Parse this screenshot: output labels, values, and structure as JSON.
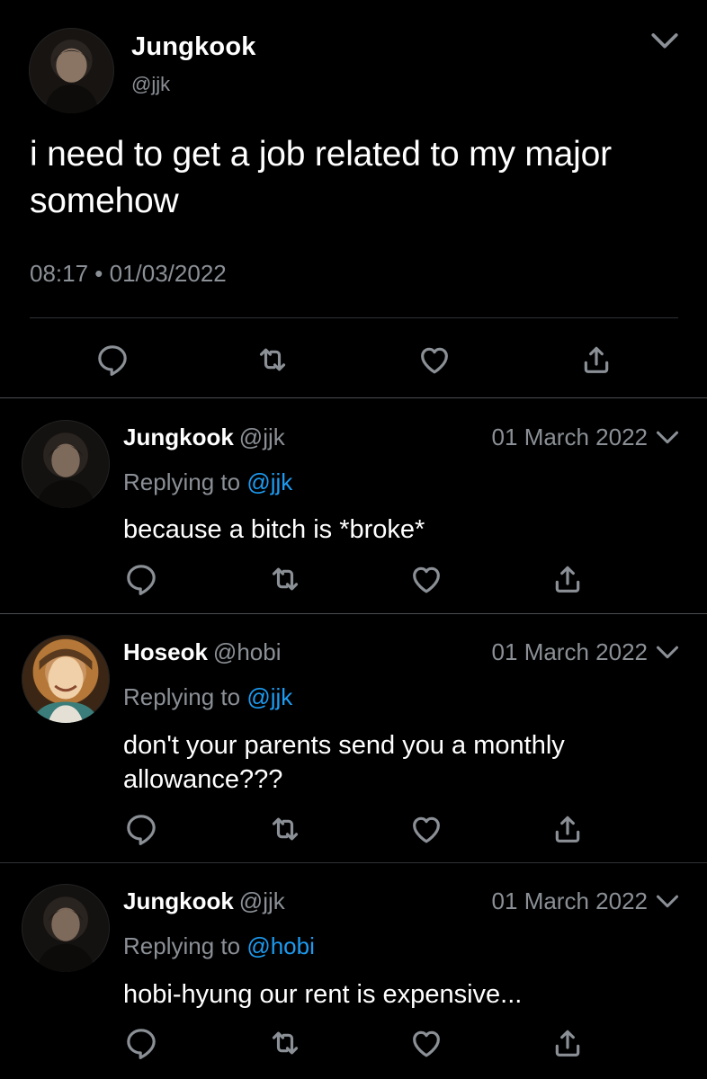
{
  "main_tweet": {
    "author_name": "Jungkook",
    "handle": "@jjk",
    "text": "i need to get a job related to my major somehow",
    "timestamp": "08:17 • 01/03/2022",
    "avatar_icon": "avatar-photo",
    "menu_icon": "chevron-down-icon"
  },
  "replies": [
    {
      "author_name": "Jungkook",
      "handle": "@jjk",
      "date": "01 March 2022",
      "replying_prefix": "Replying to ",
      "replying_to": "@jjk",
      "text": "because a bitch is *broke*"
    },
    {
      "author_name": "Hoseok",
      "handle": "@hobi",
      "date": "01 March 2022",
      "replying_prefix": "Replying to ",
      "replying_to": "@jjk",
      "text": "don't your parents send you a monthly allowance???"
    },
    {
      "author_name": "Jungkook",
      "handle": "@jjk",
      "date": "01 March 2022",
      "replying_prefix": "Replying to ",
      "replying_to": "@hobi",
      "text": "hobi-hyung our rent is expensive..."
    }
  ],
  "actions": [
    "reply-icon",
    "retweet-icon",
    "like-icon",
    "share-icon"
  ],
  "colors": {
    "background": "#000000",
    "text": "#ffffff",
    "secondary": "#8b9096",
    "mention": "#1d9bf0",
    "divider": "#2f3336"
  }
}
